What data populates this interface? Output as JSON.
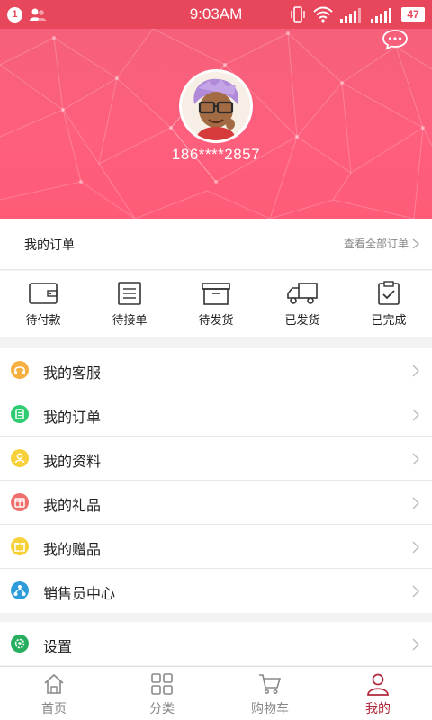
{
  "status_bar": {
    "notification_count": "1",
    "time": "9:03AM",
    "battery": "47"
  },
  "profile": {
    "phone": "186****2857"
  },
  "orders": {
    "title": "我的订单",
    "view_all": "查看全部订单",
    "items": [
      {
        "label": "待付款",
        "icon": "wallet-icon"
      },
      {
        "label": "待接单",
        "icon": "list-icon"
      },
      {
        "label": "待发货",
        "icon": "box-icon"
      },
      {
        "label": "已发货",
        "icon": "truck-icon"
      },
      {
        "label": "已完成",
        "icon": "clipboard-check-icon"
      }
    ]
  },
  "menu": [
    {
      "label": "我的客服",
      "icon": "headset-icon",
      "color": "#f5b041"
    },
    {
      "label": "我的订单",
      "icon": "order-icon",
      "color": "#2ecc71"
    },
    {
      "label": "我的资料",
      "icon": "profile-icon",
      "color": "#f7d13a"
    },
    {
      "label": "我的礼品",
      "icon": "gift-icon",
      "color": "#ef6f6c"
    },
    {
      "label": "我的赠品",
      "icon": "present-icon",
      "color": "#f7d13a"
    },
    {
      "label": "销售员中心",
      "icon": "network-icon",
      "color": "#2d9cdb"
    }
  ],
  "settings": {
    "label": "设置",
    "icon": "gear-icon",
    "color": "#27ae60"
  },
  "tabbar": {
    "items": [
      {
        "label": "首页",
        "icon": "home-icon"
      },
      {
        "label": "分类",
        "icon": "grid-icon"
      },
      {
        "label": "购物车",
        "icon": "cart-icon"
      },
      {
        "label": "我的",
        "icon": "person-icon"
      }
    ],
    "active": "我的"
  },
  "colors": {
    "header": "#fe5f7c",
    "accent": "#b0283a",
    "status_bar": "#e8465b"
  }
}
